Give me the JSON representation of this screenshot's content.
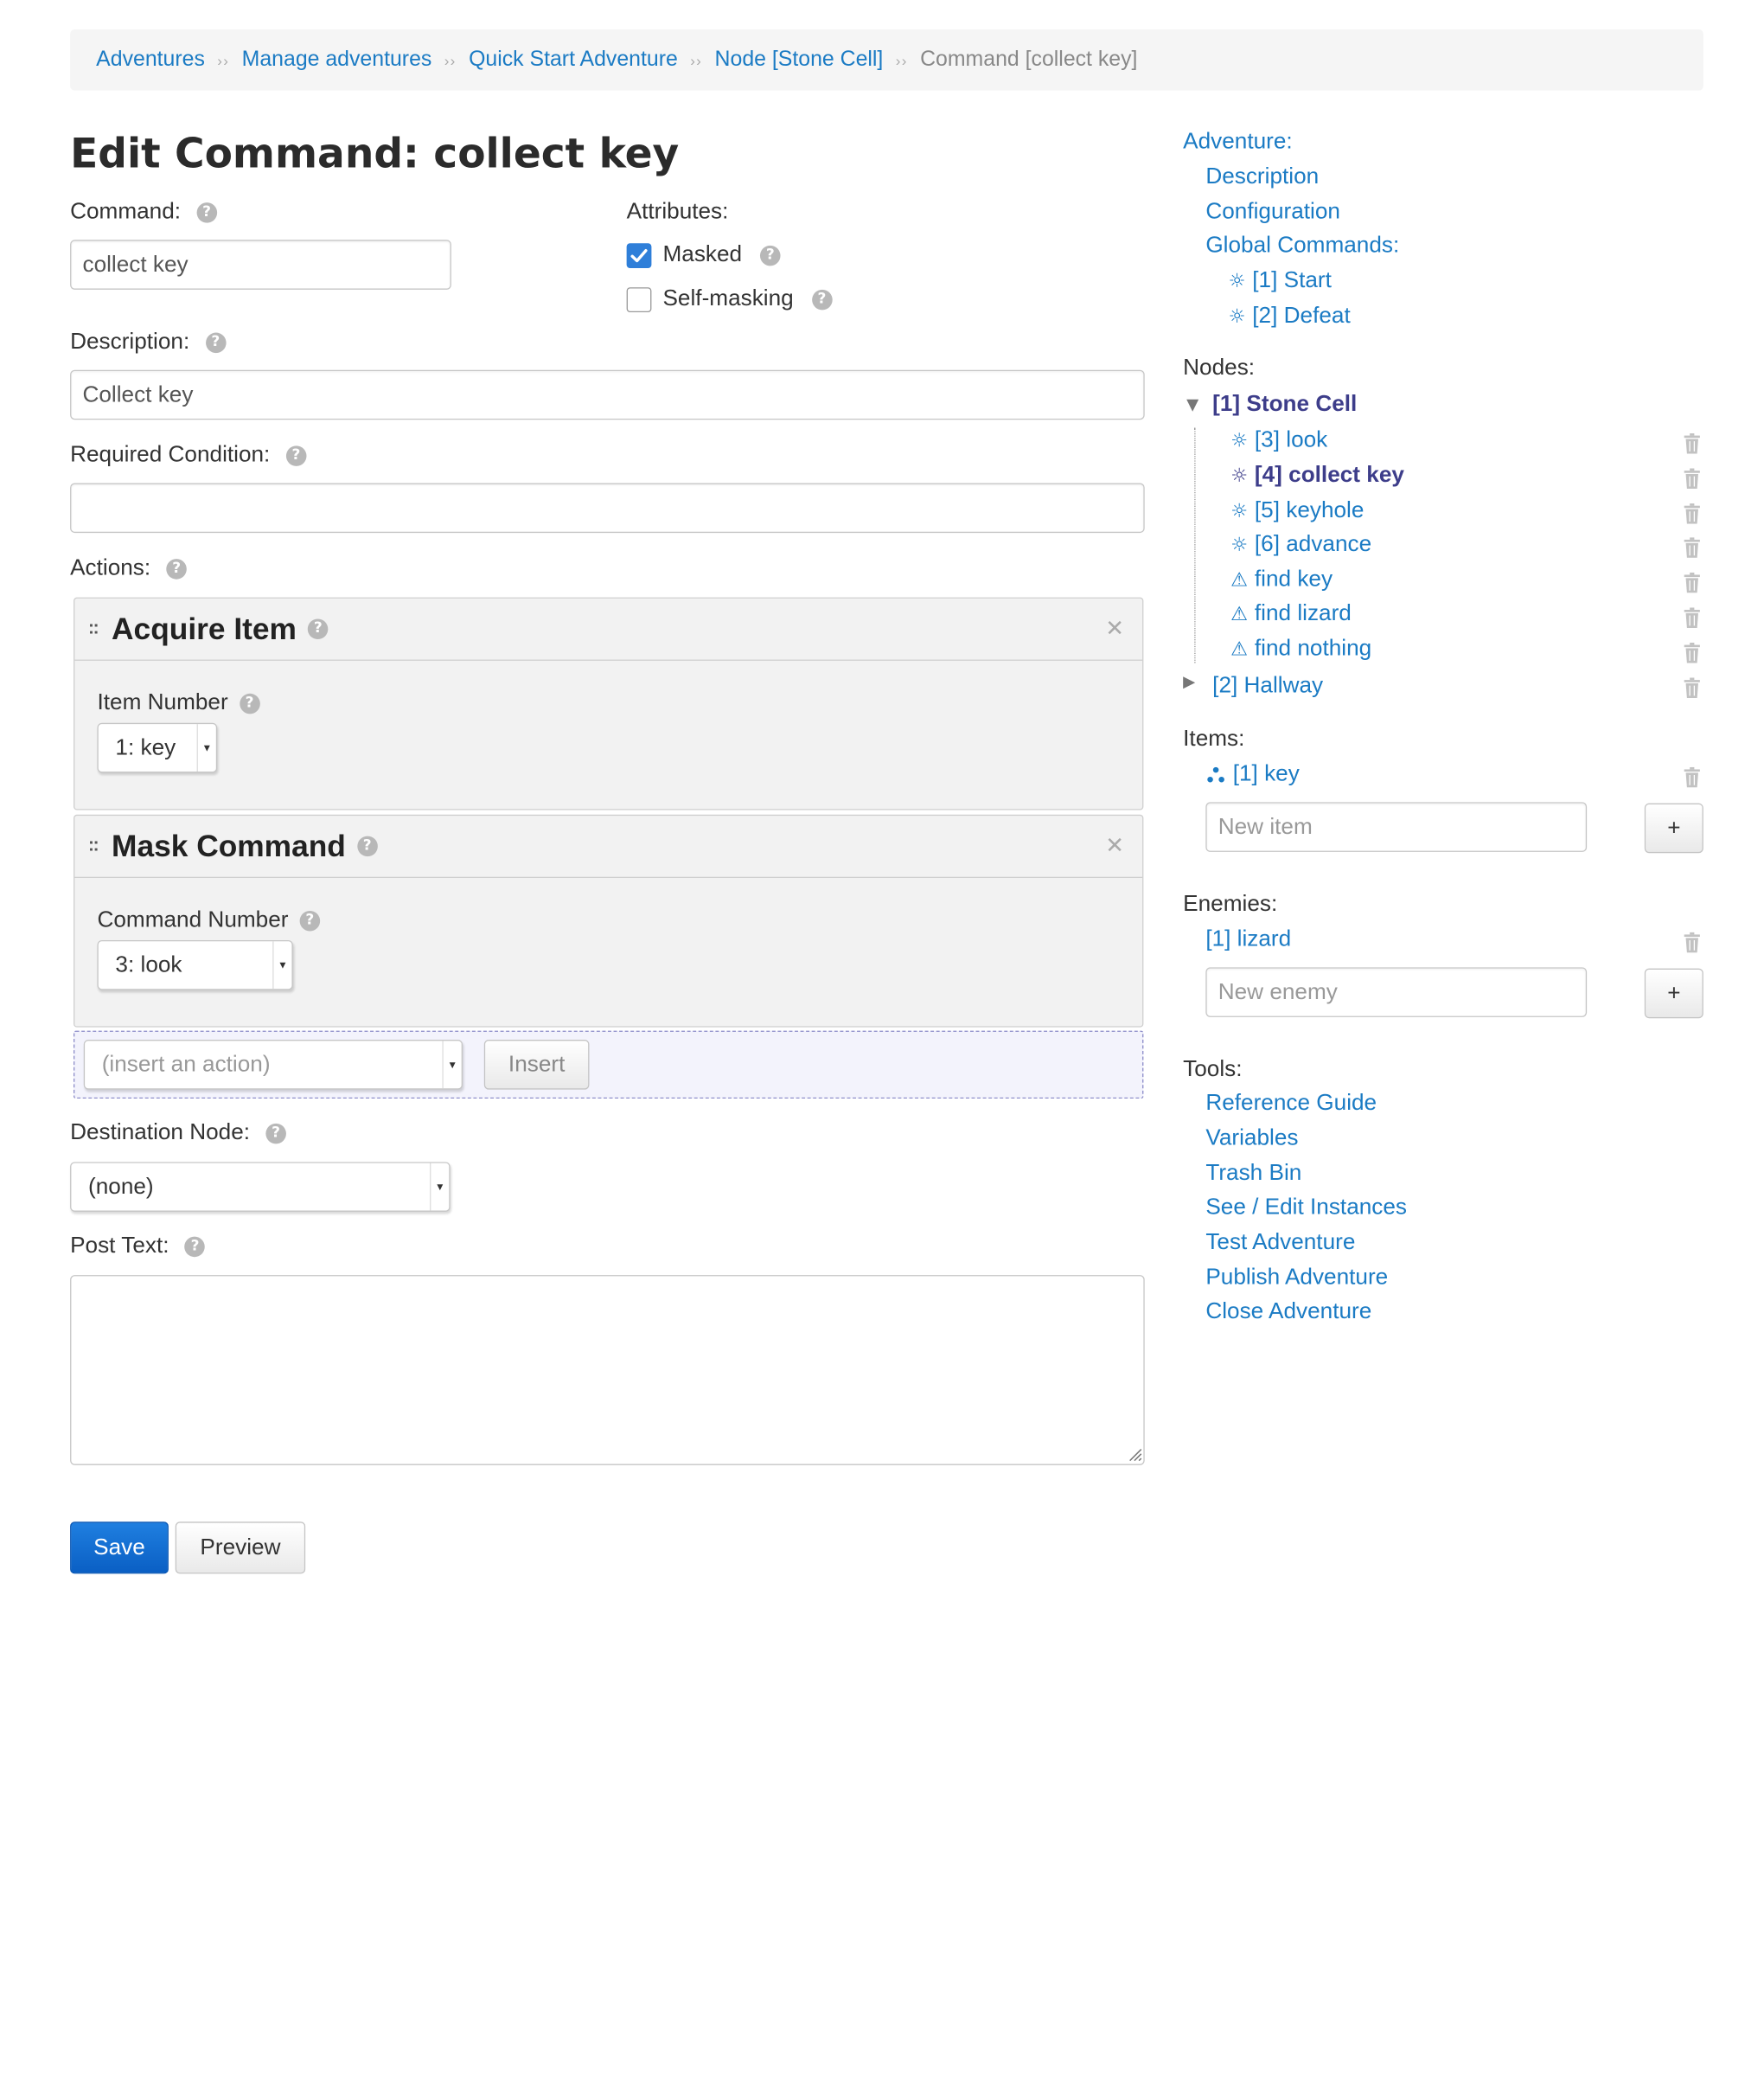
{
  "breadcrumb": {
    "items": [
      "Adventures",
      "Manage adventures",
      "Quick Start Adventure",
      "Node [Stone Cell]"
    ],
    "current": "Command [collect key]",
    "separator": "››"
  },
  "page": {
    "title": "Edit Command: collect key"
  },
  "form": {
    "command": {
      "label": "Command:",
      "value": "collect key"
    },
    "attributes": {
      "label": "Attributes:",
      "masked": {
        "label": "Masked",
        "checked": true
      },
      "self_masking": {
        "label": "Self-masking",
        "checked": false
      }
    },
    "description": {
      "label": "Description:",
      "value": "Collect key"
    },
    "required_condition": {
      "label": "Required Condition:",
      "value": ""
    },
    "actions": {
      "label": "Actions:",
      "list": [
        {
          "title": "Acquire Item",
          "field_label": "Item Number",
          "selected": "1: key"
        },
        {
          "title": "Mask Command",
          "field_label": "Command Number",
          "selected": "3: look"
        }
      ],
      "insert": {
        "placeholder": "(insert an action)",
        "button": "Insert"
      }
    },
    "destination_node": {
      "label": "Destination Node:",
      "selected": "(none)"
    },
    "post_text": {
      "label": "Post Text:",
      "value": ""
    },
    "buttons": {
      "save": "Save",
      "preview": "Preview"
    }
  },
  "sidebar": {
    "adventure": {
      "heading": "Adventure:",
      "description": "Description",
      "configuration": "Configuration",
      "global_commands": {
        "heading": "Global Commands:",
        "items": [
          "[1] Start",
          "[2] Defeat"
        ]
      }
    },
    "nodes": {
      "heading": "Nodes:",
      "expanded": {
        "label": "[1] Stone Cell",
        "commands": [
          "[3] look",
          "[4] collect key",
          "[5] keyhole",
          "[6] advance"
        ],
        "events": [
          "find key",
          "find lizard",
          "find nothing"
        ]
      },
      "collapsed": [
        "[2] Hallway"
      ]
    },
    "items": {
      "heading": "Items:",
      "list": [
        "[1] key"
      ],
      "new_placeholder": "New item",
      "add": "+"
    },
    "enemies": {
      "heading": "Enemies:",
      "list": [
        "[1] lizard"
      ],
      "new_placeholder": "New enemy",
      "add": "+"
    },
    "tools": {
      "heading": "Tools:",
      "links": [
        "Reference Guide",
        "Variables",
        "Trash Bin",
        "See / Edit Instances",
        "Test Adventure",
        "Publish Adventure",
        "Close Adventure"
      ]
    }
  },
  "icons": {
    "help": "help-icon",
    "command": "gear-icon",
    "event": "warning-icon",
    "item": "item-dots-icon",
    "delete": "trash-icon"
  },
  "colors": {
    "link": "#1b7bc4",
    "active_link": "#3d3d8a",
    "primary_button": "#0a5fc4",
    "checkbox_checked": "#2f7fd9"
  }
}
